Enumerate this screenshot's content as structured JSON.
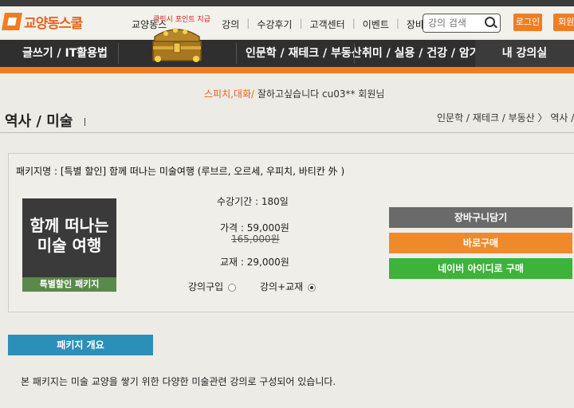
{
  "header": {
    "logo": "교양동스쿨",
    "menu": [
      "교양동스",
      "강의",
      "수강후기",
      "고객센터",
      "이벤트",
      "장바구니"
    ],
    "search_placeholder": "강의 검색",
    "login": "로그인",
    "join": "회원"
  },
  "promo": {
    "chest_label": "클릭시 포인트 지급"
  },
  "nav": {
    "items": [
      "글쓰기 / IT활용법",
      "인문학 / 재테크 / 부동산",
      "취미 / 실용 / 건강 / 암기"
    ],
    "my_lecture": "내 강의실"
  },
  "welcome": {
    "highlight": "스피치,대화/",
    "text": "잘하고싶습니다 cu03** 회원님"
  },
  "page": {
    "title": "역사 / 미술",
    "breadcrumb": "인문학 / 재테크 / 부동산 〉 역사 /"
  },
  "package": {
    "name_line": "패키지명 : [특별 할인] 함께 떠나는 미술여행 (루브르, 오르세, 우피치, 바티칸 外 )",
    "thumb_title_1": "함께 떠나는",
    "thumb_title_2": "미술 여행",
    "thumb_band": "특별할인 패키지",
    "duration": "수강기간 : 180일",
    "price": "가격 : 59,000원",
    "original_price": "165,000원",
    "material": "교재 : 29,000원",
    "option_lecture": "강의구입",
    "option_lecture_book": "강의+교재",
    "selected_option": "강의+교재"
  },
  "buttons": {
    "cart": "장바구니담기",
    "buy": "바로구매",
    "naver": "네이버 아이디로 구매"
  },
  "overview": {
    "tab": "패키지 개요",
    "description": "본 패키지는 미술 교양을 쌓기 위한 다양한 미술관련 강의로 구성되어 있습니다."
  },
  "colors": {
    "accent": "#ef7d22",
    "nav": "#2f2f2f",
    "naver_green": "#3db33a",
    "tab_blue": "#2b8fb8"
  }
}
